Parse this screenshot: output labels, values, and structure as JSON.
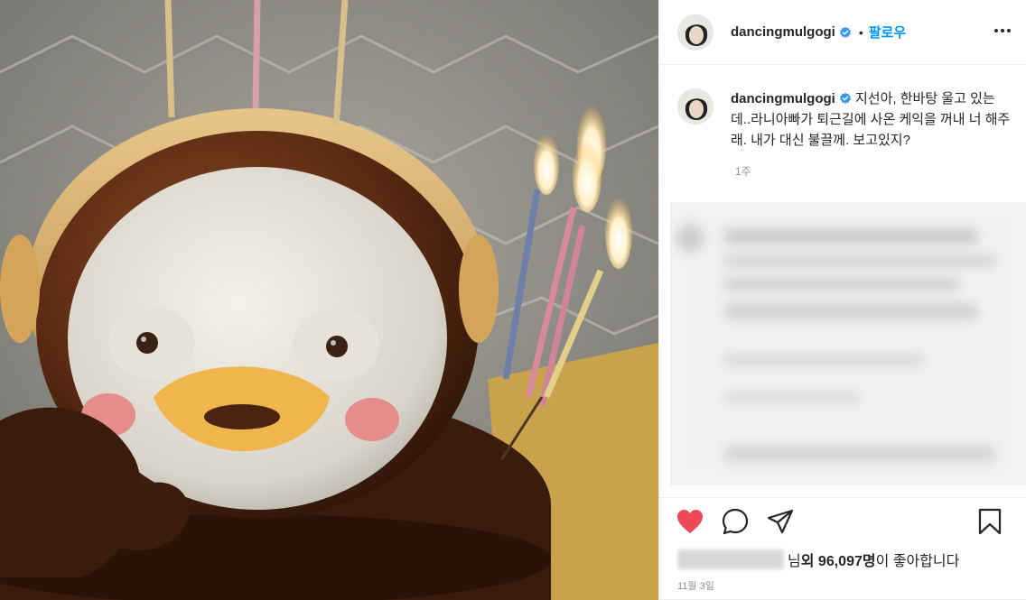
{
  "post": {
    "username": "dancingmulgogi",
    "follow_label": "팔로우",
    "separator": "•",
    "caption": "지선아, 한바탕 울고 있는데..라니아빠가 퇴근길에 사온 케익을 꺼내 너 해주래. 내가 대신 불끌께. 보고있지?",
    "caption_age": "1주",
    "likes_prefix": "님 ",
    "likes_and": "외",
    "likes_count": "96,097명",
    "likes_suffix": "이 좋아합니다",
    "date": "11월 3일"
  },
  "icons": {
    "verified": "verified-badge-icon",
    "more": "more-options-icon",
    "like": "heart-icon",
    "comment": "comment-icon",
    "share": "share-icon",
    "save": "bookmark-icon"
  },
  "colors": {
    "link_blue": "#0095f6",
    "verified_blue": "#3897f0",
    "heart_red": "#ed4956",
    "meta_gray": "#8e8e8e"
  }
}
